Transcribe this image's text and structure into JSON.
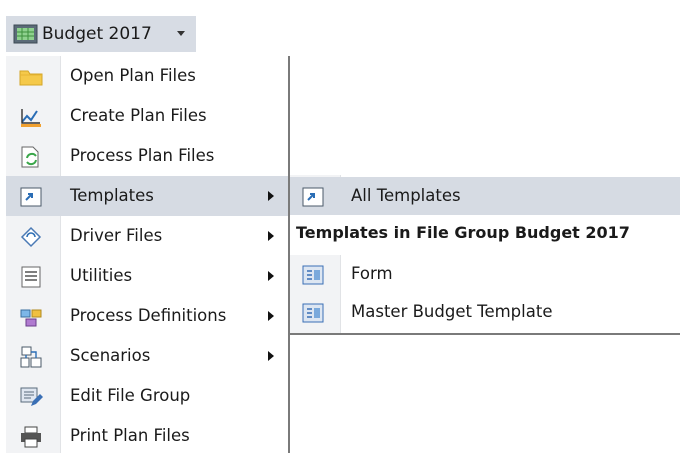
{
  "top_button": {
    "label": "Budget 2017",
    "icon": "spreadsheet-icon"
  },
  "menu": {
    "items": [
      {
        "label": "Open Plan Files",
        "icon": "folder-icon",
        "submenu": false
      },
      {
        "label": "Create Plan Files",
        "icon": "create-icon",
        "submenu": false
      },
      {
        "label": "Process Plan Files",
        "icon": "process-icon",
        "submenu": false
      },
      {
        "label": "Templates",
        "icon": "templates-icon",
        "submenu": true,
        "highlighted": true
      },
      {
        "label": "Driver Files",
        "icon": "driver-icon",
        "submenu": true
      },
      {
        "label": "Utilities",
        "icon": "utilities-icon",
        "submenu": true
      },
      {
        "label": "Process Definitions",
        "icon": "process-definitions-icon",
        "submenu": true
      },
      {
        "label": "Scenarios",
        "icon": "scenarios-icon",
        "submenu": true
      },
      {
        "label": "Edit File Group",
        "icon": "edit-icon",
        "submenu": false
      },
      {
        "label": "Print Plan Files",
        "icon": "printer-icon",
        "submenu": false
      }
    ]
  },
  "submenu": {
    "all_templates": "All Templates",
    "group_header": "Templates in File Group Budget 2017",
    "items": [
      {
        "label": "Form",
        "icon": "template-icon"
      },
      {
        "label": "Master Budget Template",
        "icon": "template-icon"
      }
    ]
  },
  "colors": {
    "highlight": "#d6dbe3",
    "gutter": "#f2f3f5",
    "border": "#7a7a7a"
  }
}
